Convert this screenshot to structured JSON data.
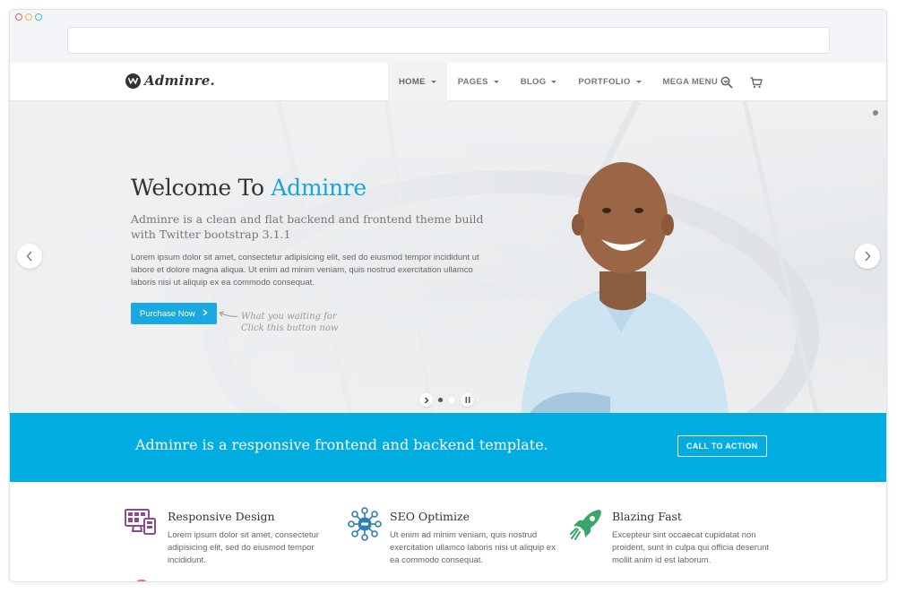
{
  "nav": {
    "brand": "Adminre.",
    "items": [
      {
        "label": "HOME",
        "active": true
      },
      {
        "label": "PAGES",
        "active": false
      },
      {
        "label": "BLOG",
        "active": false
      },
      {
        "label": "PORTFOLIO",
        "active": false
      },
      {
        "label": "MEGA MENU",
        "active": false
      }
    ],
    "icons": [
      "search-icon",
      "cart-icon"
    ]
  },
  "hero": {
    "title_prefix": "Welcome To ",
    "title_accent": "Adminre",
    "subtitle": "Adminre is a clean and flat backend and frontend theme build with Twitter bootstrap 3.1.1",
    "description": "Lorem ipsum dolor sit amet, consectetur adipisicing elit, sed do eiusmod tempor incididunt ut labore et dolore magna aliqua. Ut enim ad minim veniam, quis nostrud exercitation ullamco laboris nisi ut aliquip ex ea commodo consequat.",
    "button_label": "Purchase Now",
    "hint_line1": "What you waiting for",
    "hint_line2": "Click this button now",
    "accent_color": "#1aa3dc"
  },
  "cta": {
    "text": "Adminre is a responsive frontend and backend template.",
    "button_label": "CALL TO ACTION",
    "background_color": "#00ade1"
  },
  "features": [
    {
      "title": "Responsive Design",
      "text": "Lorem ipsum dolor sit amet, consectetur adipisicing elit, sed do eiusmod tempor incididunt.",
      "icon": "devices-icon",
      "color": "#8c4a8f"
    },
    {
      "title": "SEO Optimize",
      "text": "Ut enim ad minim veniam, quis nostrud exercitation ullamco laboris nisi ut aliquip ex ea commodo consequat.",
      "icon": "seo-network-icon",
      "color": "#2f7fb3"
    },
    {
      "title": "Blazing Fast",
      "text": "Excepteur sint occaecat cupidatat non proident, sunt in culpa qui officia deserunt mollit anim id est laborum.",
      "icon": "rocket-icon",
      "color": "#3aa56a"
    }
  ]
}
